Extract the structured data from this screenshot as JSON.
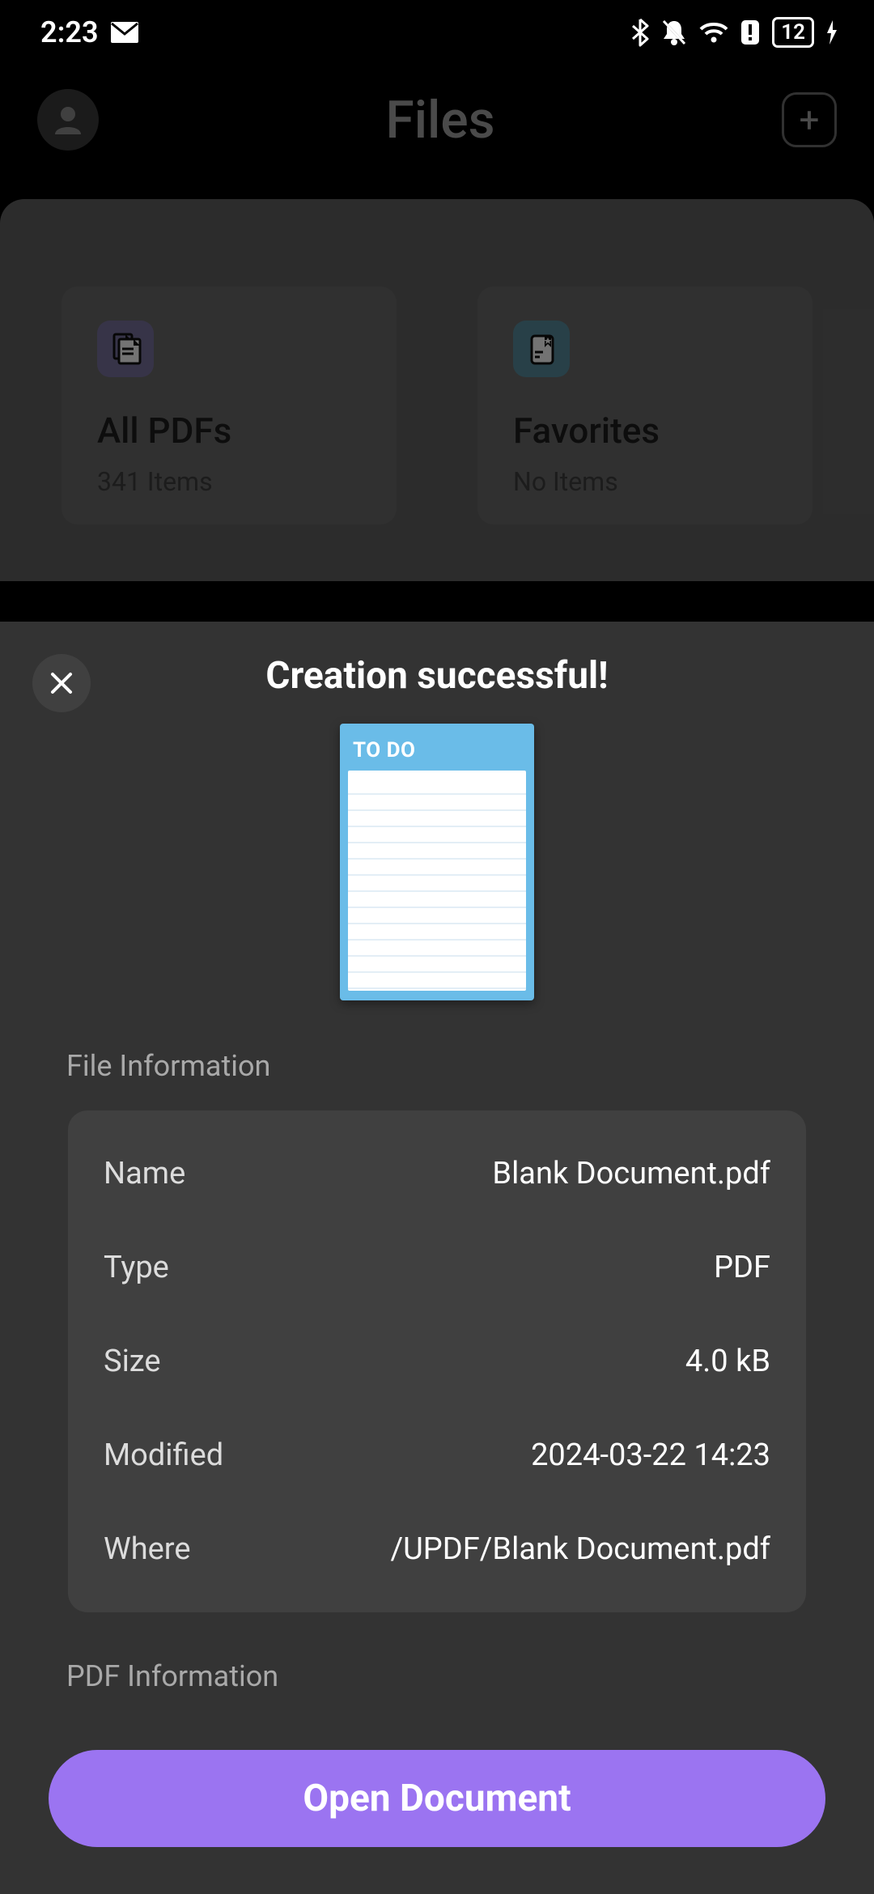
{
  "status": {
    "time": "2:23",
    "battery_pct": "12"
  },
  "header": {
    "title": "Files"
  },
  "cards": {
    "all_pdfs": {
      "title": "All PDFs",
      "subtitle": "341 Items"
    },
    "favorites": {
      "title": "Favorites",
      "subtitle": "No Items"
    }
  },
  "sheet": {
    "title": "Creation successful!",
    "thumb_label": "TO DO",
    "file_info_label": "File Information",
    "pdf_info_label": "PDF Information",
    "rows": {
      "name": {
        "k": "Name",
        "v": "Blank Document.pdf"
      },
      "type": {
        "k": "Type",
        "v": "PDF"
      },
      "size": {
        "k": "Size",
        "v": "4.0 kB"
      },
      "modified": {
        "k": "Modified",
        "v": "2024-03-22 14:23"
      },
      "where": {
        "k": "Where",
        "v": "/UPDF/Blank Document.pdf"
      }
    },
    "open_button": "Open Document"
  }
}
